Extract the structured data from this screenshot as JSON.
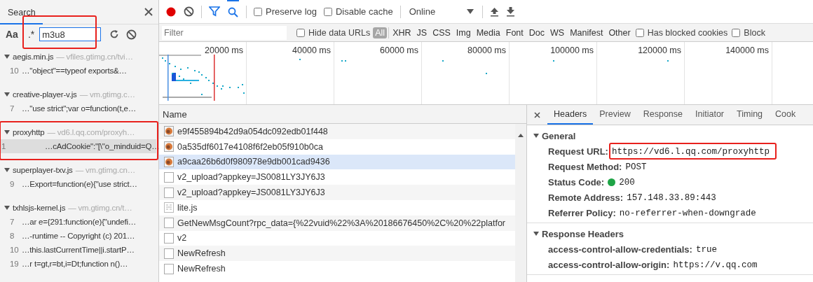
{
  "search_panel": {
    "title": "Search",
    "match_case_label": "Aa",
    "regex_label": ".*",
    "query": "m3u8",
    "query_highlighted": true,
    "results": [
      {
        "file": "aegis.min.js",
        "location": "— vfiles.gtimg.cn/tvi…",
        "highlighted": false,
        "matches": [
          {
            "line": "10",
            "text": "…\"object\"==typeof exports&…",
            "selected": false
          }
        ]
      },
      {
        "file": "creative-player-v.js",
        "location": "— vm.gtimg.c…",
        "highlighted": false,
        "matches": [
          {
            "line": "7",
            "text": "…\"use strict\";var o=function(t,e…",
            "selected": false
          }
        ]
      },
      {
        "file": "proxyhttp",
        "location": "— vd6.l.qq.com/proxyh…",
        "highlighted": true,
        "matches": [
          {
            "line": "1",
            "text": "…cAdCookie\":\"[\\\"o_minduid=Q…",
            "selected": true
          }
        ]
      },
      {
        "file": "superplayer-txv.js",
        "location": "— vm.gtimg.cn…",
        "highlighted": false,
        "matches": [
          {
            "line": "9",
            "text": "…Export=function(e){\"use strict…",
            "selected": false
          }
        ]
      },
      {
        "file": "txhlsjs-kernel.js",
        "location": "— vm.gtimg.cn/t…",
        "highlighted": false,
        "matches": [
          {
            "line": "7",
            "text": "…ar e={291:function(e){\"undefi…",
            "selected": false
          },
          {
            "line": "8",
            "text": "…-runtime -- Copyright (c) 201…",
            "selected": false
          },
          {
            "line": "10",
            "text": "…this.lastCurrentTime||i.startP…",
            "selected": false
          },
          {
            "line": "19",
            "text": "…r t=gt,r=bt,i=Dt;function n()…",
            "selected": false
          }
        ]
      }
    ]
  },
  "toolbar": {
    "recording": true,
    "filter_on": true,
    "search_on": true,
    "checkboxes": [
      {
        "label": "Preserve log",
        "checked": false
      },
      {
        "label": "Disable cache",
        "checked": false
      }
    ],
    "throttling": "Online"
  },
  "filter_bar": {
    "placeholder": "Filter",
    "hide_data_urls": {
      "label": "Hide data URLs",
      "checked": false
    },
    "types": [
      {
        "label": "All",
        "selected": true
      },
      {
        "label": "XHR",
        "selected": false
      },
      {
        "label": "JS",
        "selected": false
      },
      {
        "label": "CSS",
        "selected": false
      },
      {
        "label": "Img",
        "selected": false
      },
      {
        "label": "Media",
        "selected": false
      },
      {
        "label": "Font",
        "selected": false
      },
      {
        "label": "Doc",
        "selected": false
      },
      {
        "label": "WS",
        "selected": false
      },
      {
        "label": "Manifest",
        "selected": false
      },
      {
        "label": "Other",
        "selected": false
      }
    ],
    "extra_checkboxes": [
      {
        "label": "Has blocked cookies",
        "checked": false
      },
      {
        "label": "Block",
        "checked": false
      }
    ]
  },
  "overview": {
    "ticks": [
      "20000 ms",
      "40000 ms",
      "60000 ms",
      "80000 ms",
      "100000 ms",
      "120000 ms",
      "140000 ms"
    ]
  },
  "requests": {
    "column": "Name",
    "rows": [
      {
        "name": "e9f455894b42d9a054dc092edb01f448",
        "kind": "image",
        "selected": false
      },
      {
        "name": "0a535df6017e4108f6f2eb05f910b0ca",
        "kind": "image",
        "selected": false
      },
      {
        "name": "a9caa26b6d0f980978e9db001cad9436",
        "kind": "image",
        "selected": true
      },
      {
        "name": "v2_upload?appkey=JS0081LY3JY6J3",
        "kind": "document",
        "selected": false
      },
      {
        "name": "v2_upload?appkey=JS0081LY3JY6J3",
        "kind": "document",
        "selected": false
      },
      {
        "name": "lite.js",
        "kind": "script",
        "selected": false
      },
      {
        "name": "GetNewMsgCount?rpc_data={%22vuid%22%3A%20186676450%2C%20%22platfor",
        "kind": "document",
        "selected": false
      },
      {
        "name": "v2",
        "kind": "document",
        "selected": false
      },
      {
        "name": "NewRefresh",
        "kind": "document",
        "selected": false
      },
      {
        "name": "NewRefresh",
        "kind": "document",
        "selected": false
      }
    ]
  },
  "details": {
    "tabs": [
      {
        "label": "Headers",
        "selected": true
      },
      {
        "label": "Preview",
        "selected": false
      },
      {
        "label": "Response",
        "selected": false
      },
      {
        "label": "Initiator",
        "selected": false
      },
      {
        "label": "Timing",
        "selected": false
      },
      {
        "label": "Cook",
        "selected": false
      }
    ],
    "sections": [
      {
        "title": "General",
        "expanded": true,
        "fields": [
          {
            "name": "Request URL:",
            "value": "https://vd6.l.qq.com/proxyhttp",
            "kind": "text",
            "highlighted": true
          },
          {
            "name": "Request Method:",
            "value": "POST",
            "kind": "text",
            "highlighted": false
          },
          {
            "name": "Status Code:",
            "value": "200",
            "kind": "status",
            "highlighted": false
          },
          {
            "name": "Remote Address:",
            "value": "157.148.33.89:443",
            "kind": "text",
            "highlighted": false
          },
          {
            "name": "Referrer Policy:",
            "value": "no-referrer-when-downgrade",
            "kind": "text",
            "highlighted": false
          }
        ]
      },
      {
        "title": "Response Headers",
        "expanded": true,
        "fields": [
          {
            "name": "access-control-allow-credentials:",
            "value": "true",
            "kind": "text",
            "highlighted": false
          },
          {
            "name": "access-control-allow-origin:",
            "value": "https://v.qq.com",
            "kind": "text",
            "highlighted": false
          }
        ]
      }
    ]
  }
}
